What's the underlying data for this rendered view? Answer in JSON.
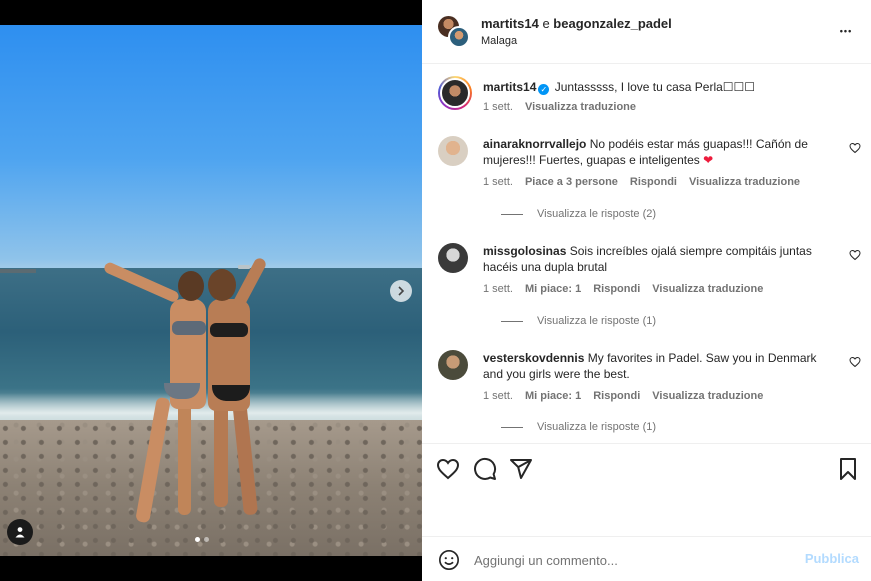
{
  "post": {
    "header_user1": "martits14",
    "header_sep": "e",
    "header_user2": "beagonzalez_padel",
    "location": "Malaga"
  },
  "caption": {
    "username": "martits14",
    "text": "Juntasssss, I love tu casa Perla☐☐☐",
    "time": "1 sett.",
    "translate": "Visualizza traduzione"
  },
  "comments": [
    {
      "username": "ainaraknorrvallejo",
      "text": "No podéis estar más guapas!!! Cañón de mujeres!!! Fuertes, guapas e inteligentes",
      "emoji": "❤",
      "time": "1 sett.",
      "likes": "Piace a 3 persone",
      "reply": "Rispondi",
      "translate": "Visualizza traduzione",
      "view_replies": "Visualizza le risposte (2)"
    },
    {
      "username": "missgolosinas",
      "text": "Sois increíbles ojalá siempre compitáis juntas hacéis una dupla brutal",
      "emoji": "",
      "time": "1 sett.",
      "likes": "Mi piace: 1",
      "reply": "Rispondi",
      "translate": "Visualizza traduzione",
      "view_replies": "Visualizza le risposte (1)"
    },
    {
      "username": "vesterskovdennis",
      "text": "My favorites in Padel. Saw you in Denmark and you girls were the best.",
      "emoji": "",
      "time": "1 sett.",
      "likes": "Mi piace: 1",
      "reply": "Rispondi",
      "translate": "Visualizza traduzione",
      "view_replies": "Visualizza le risposte (1)"
    }
  ],
  "add_comment": {
    "placeholder": "Aggiungi un commento...",
    "publish": "Pubblica"
  },
  "icons": {
    "more": "•••",
    "verified": "✓"
  },
  "colors": {
    "accent": "#0095f6",
    "publish_disabled": "#b3dbff",
    "heart": "#ed1c3c"
  }
}
